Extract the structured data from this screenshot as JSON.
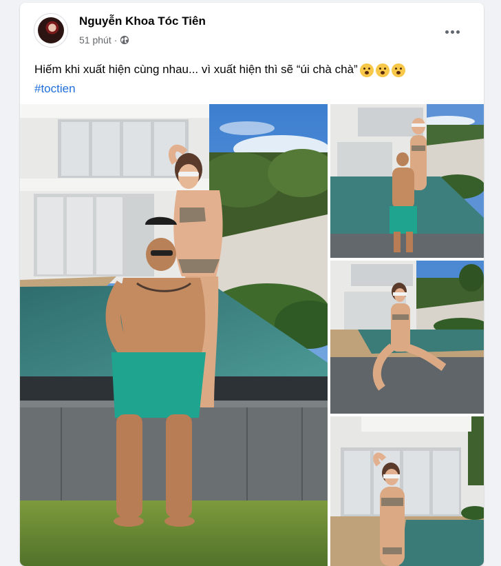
{
  "post": {
    "author": "Nguyễn Khoa Tóc Tiên",
    "time": "51 phút",
    "separator": "·",
    "privacy_icon": "globe-icon",
    "more_icon": "more-options-icon",
    "caption": "Hiếm khi xuất hiện cùng nhau... vì xuất hiện thì sẽ “úi chà chà”",
    "caption_emojis": [
      "hushed-face-emoji",
      "hushed-face-emoji",
      "hushed-face-emoji"
    ],
    "hashtag": "#toctien"
  },
  "photos": [
    {
      "slot": "main",
      "content": "couple-by-pool"
    },
    {
      "slot": "right-top",
      "content": "couple-walking-pool"
    },
    {
      "slot": "right-middle",
      "content": "woman-sitting-pool-edge"
    },
    {
      "slot": "right-bottom",
      "content": "woman-posing-villa"
    }
  ],
  "colors": {
    "background": "#f0f2f5",
    "card": "#ffffff",
    "text": "#050505",
    "secondary_text": "#65676b",
    "link": "#216fdb"
  }
}
